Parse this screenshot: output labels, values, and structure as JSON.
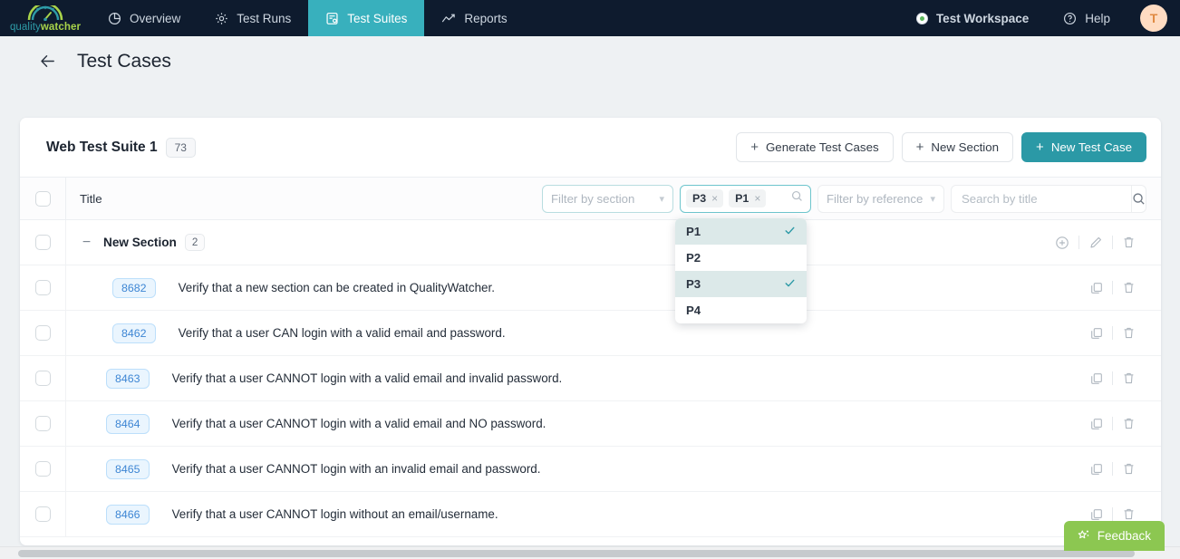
{
  "nav": {
    "logo": {
      "part1": "quality",
      "part2": "watcher",
      "icon": "gauge-icon"
    },
    "items": [
      {
        "label": "Overview",
        "icon": "pie-chart-icon",
        "active": false
      },
      {
        "label": "Test Runs",
        "icon": "gear-icon",
        "active": false
      },
      {
        "label": "Test Suites",
        "icon": "test-suite-icon",
        "active": true
      },
      {
        "label": "Reports",
        "icon": "line-chart-icon",
        "active": false
      }
    ],
    "workspace": {
      "label": "Test Workspace",
      "icon": "workspace-dot-icon",
      "status_color": "#5cb85c"
    },
    "help": {
      "label": "Help",
      "icon": "help-circle-icon"
    },
    "avatar": {
      "initial": "T",
      "bg": "#ffdcc2",
      "fg": "#e08a42"
    }
  },
  "page": {
    "title": "Test Cases",
    "back_icon": "arrow-left-icon"
  },
  "suite": {
    "name": "Web Test Suite 1",
    "count": "73",
    "buttons": {
      "generate": "Generate Test Cases",
      "new_section": "New Section",
      "new_test_case": "New Test Case"
    },
    "plus": "+"
  },
  "table": {
    "column_title": "Title",
    "filters": {
      "section_placeholder": "Filter by section",
      "reference_placeholder": "Filter by reference",
      "search_placeholder": "Search by title",
      "search_value": "",
      "priority_tags": [
        "P3",
        "P1"
      ],
      "tag_remove": "×"
    },
    "dropdown": {
      "options": [
        {
          "label": "P1",
          "selected": true
        },
        {
          "label": "P2",
          "selected": false
        },
        {
          "label": "P3",
          "selected": true
        },
        {
          "label": "P4",
          "selected": false
        }
      ]
    },
    "section": {
      "name": "New Section",
      "count": "2",
      "collapse_glyph": "−"
    },
    "rows": [
      {
        "id": "8682",
        "title": "Verify that a new section can be created in QualityWatcher.",
        "indent": true
      },
      {
        "id": "8462",
        "title": "Verify that a user CAN login with a valid email and password.",
        "indent": true
      },
      {
        "id": "8463",
        "title": "Verify that a user CANNOT login with a valid email and invalid password.",
        "indent": false
      },
      {
        "id": "8464",
        "title": "Verify that a user CANNOT login with a valid email and NO password.",
        "indent": false
      },
      {
        "id": "8465",
        "title": "Verify that a user CANNOT login with an invalid email and password.",
        "indent": false
      },
      {
        "id": "8466",
        "title": "Verify that a user CANNOT login without an email/username.",
        "indent": false
      }
    ]
  },
  "feedback": {
    "label": "Feedback",
    "icon": "sparkle-star-icon",
    "color": "#8cc751"
  },
  "theme": {
    "accent": "#2b99a6",
    "nav_bg": "#0e1b2e",
    "nav_active": "#38b0bd",
    "id_badge": "#3e86d4"
  }
}
